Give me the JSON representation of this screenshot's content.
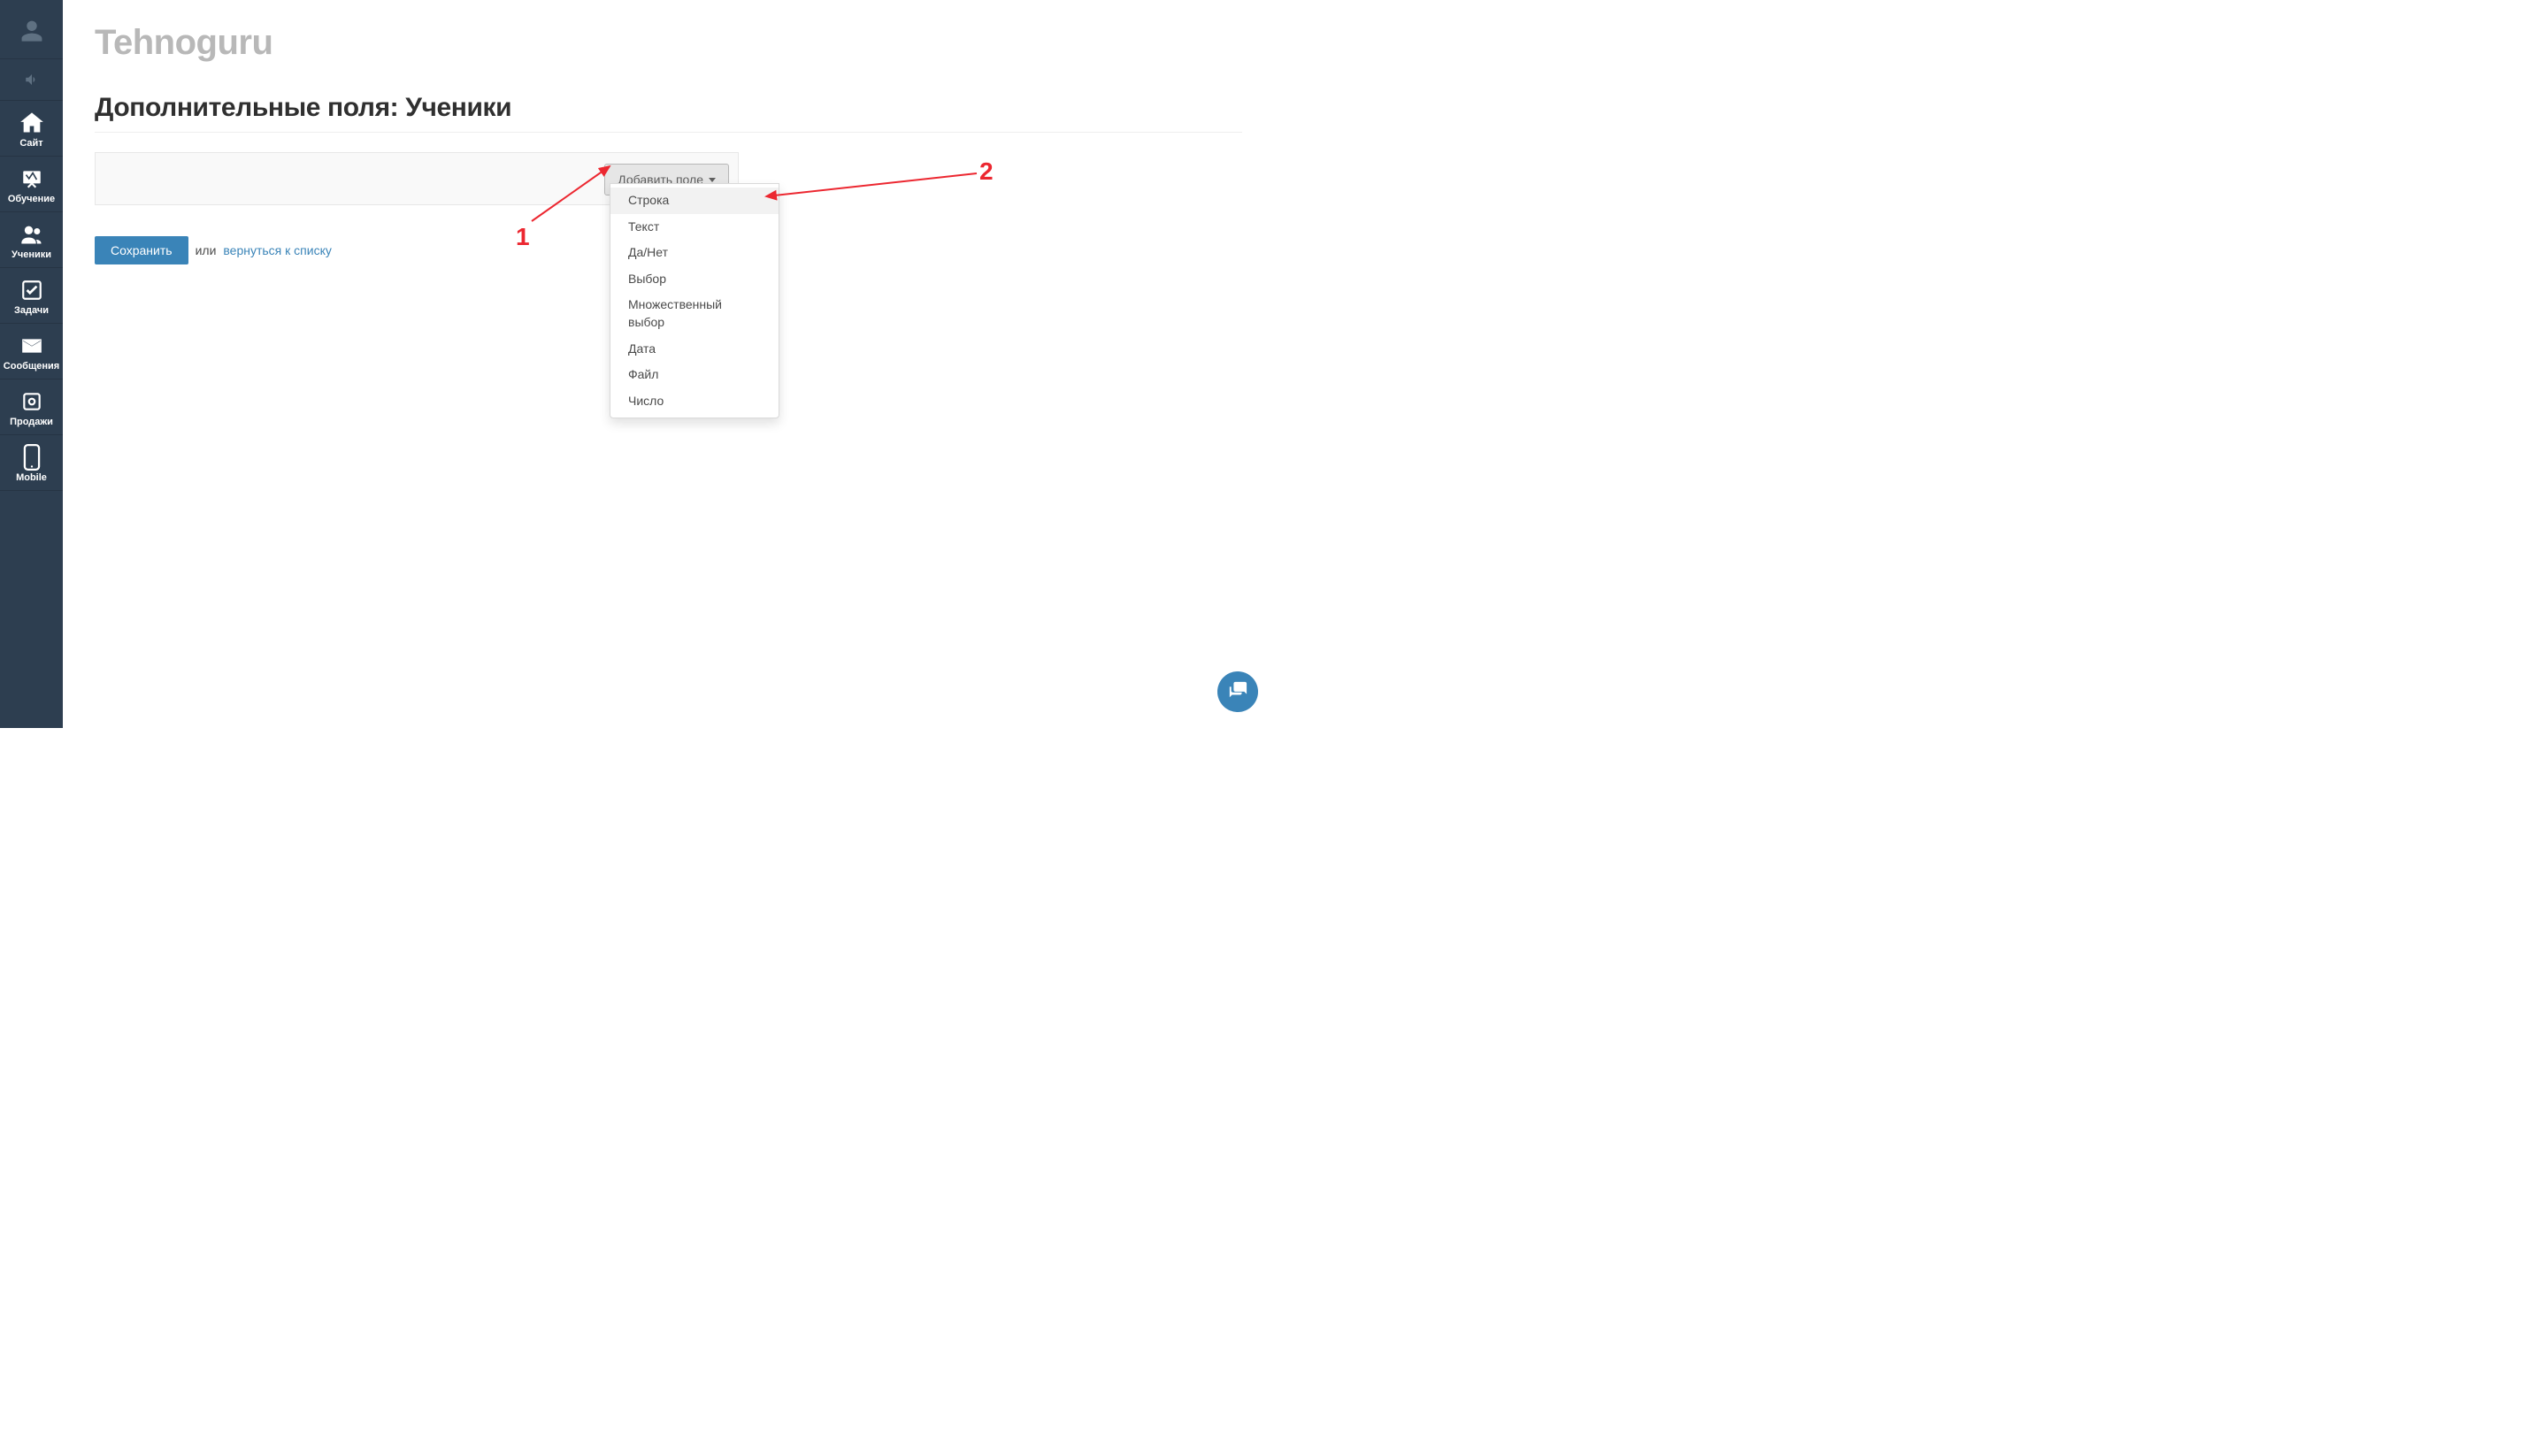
{
  "brand": "Tehnoguru",
  "page_title": "Дополнительные поля: Ученики",
  "add_field_button": "Добавить поле",
  "dropdown": {
    "items": [
      "Строка",
      "Текст",
      "Да/Нет",
      "Выбор",
      "Множественный выбор",
      "Дата",
      "Файл",
      "Число"
    ],
    "active_index": 0
  },
  "save_button": "Сохранить",
  "or_text": "или",
  "back_link": "вернуться к списку",
  "sidebar": {
    "items": [
      {
        "label": "",
        "icon": "user"
      },
      {
        "label": "",
        "icon": "sound"
      },
      {
        "label": "Сайт",
        "icon": "home"
      },
      {
        "label": "Обучение",
        "icon": "board"
      },
      {
        "label": "Ученики",
        "icon": "users"
      },
      {
        "label": "Задачи",
        "icon": "check"
      },
      {
        "label": "Сообщения",
        "icon": "mail"
      },
      {
        "label": "Продажи",
        "icon": "sales"
      },
      {
        "label": "Mobile",
        "icon": "mobile"
      }
    ]
  },
  "annotations": {
    "one": "1",
    "two": "2"
  },
  "colors": {
    "accent": "#3a84b8",
    "sidebar_bg": "#2d3e50",
    "annotation": "#ec2730"
  }
}
